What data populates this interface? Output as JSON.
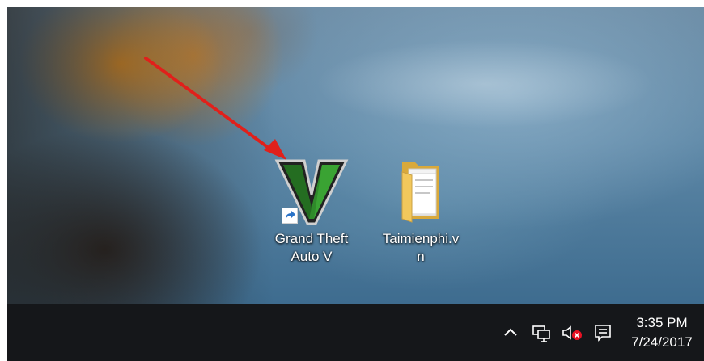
{
  "desktop": {
    "icons": [
      {
        "label": "Grand Theft\nAuto V",
        "shortcut": true,
        "icon": "gta-v-icon"
      },
      {
        "label": "Taimienphi.v\nn",
        "shortcut": false,
        "icon": "folder-icon"
      }
    ]
  },
  "annotation": {
    "color": "#e0201b"
  },
  "taskbar": {
    "tray": {
      "icons": [
        "chevron-up-icon",
        "network-icon",
        "volume-muted-icon",
        "action-center-icon"
      ]
    },
    "clock": {
      "time": "3:35 PM",
      "date": "7/24/2017"
    }
  }
}
